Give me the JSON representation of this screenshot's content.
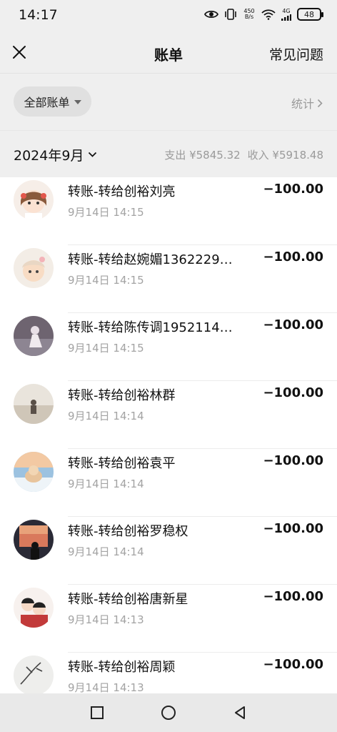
{
  "status_bar": {
    "time": "14:17",
    "net_speed_top": "450",
    "net_speed_bottom": "B/s",
    "signal_label": "4G",
    "battery": "48"
  },
  "nav": {
    "title": "账单",
    "faq": "常见问题"
  },
  "filter": {
    "chip_label": "全部账单",
    "stats_label": "统计"
  },
  "month": {
    "label": "2024年9月",
    "expense": "支出 ¥5845.32",
    "income": "收入 ¥5918.48"
  },
  "transactions": [
    {
      "title": "转账-转给创裕刘亮",
      "time": "9月14日 14:15",
      "amount": "−100.00"
    },
    {
      "title": "转账-转给赵婉媚1362229…",
      "time": "9月14日 14:15",
      "amount": "−100.00"
    },
    {
      "title": "转账-转给陈传调1952114…",
      "time": "9月14日 14:15",
      "amount": "−100.00"
    },
    {
      "title": "转账-转给创裕林群",
      "time": "9月14日 14:14",
      "amount": "−100.00"
    },
    {
      "title": "转账-转给创裕袁平",
      "time": "9月14日 14:14",
      "amount": "−100.00"
    },
    {
      "title": "转账-转给创裕罗稳权",
      "time": "9月14日 14:14",
      "amount": "−100.00"
    },
    {
      "title": "转账-转给创裕唐新星",
      "time": "9月14日 14:13",
      "amount": "−100.00"
    },
    {
      "title": "转账-转给创裕周颖",
      "time": "9月14日 14:13",
      "amount": "−100.00"
    }
  ],
  "colors": {
    "header_bg": "#efefef",
    "secondary_text": "#a3a3a3",
    "primary_text": "#111111"
  }
}
